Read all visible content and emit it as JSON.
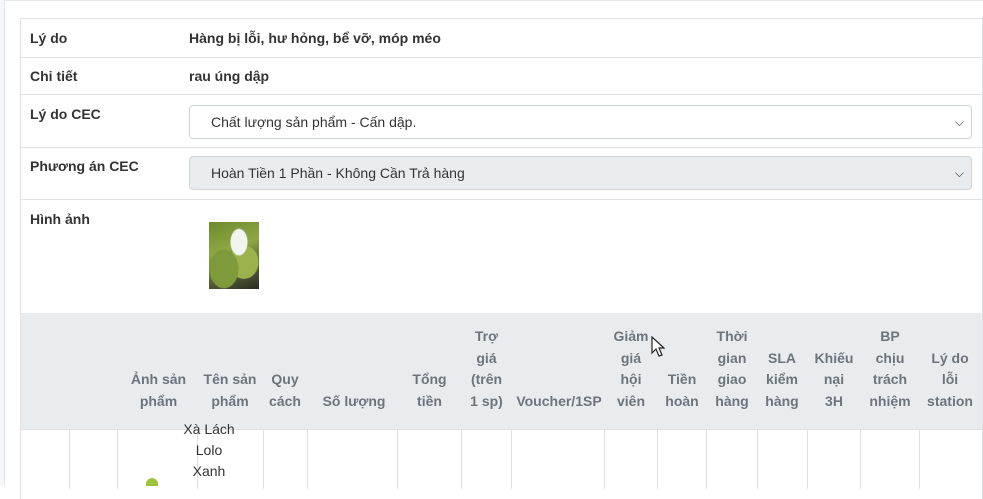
{
  "details": {
    "reason": {
      "label": "Lý do",
      "value": "Hàng bị lỗi, hư hỏng, bể vỡ, móp méo"
    },
    "detail": {
      "label": "Chi tiết",
      "value": "rau úng dập"
    },
    "cec_reason": {
      "label": "Lý do CEC",
      "selected": "Chất lượng sản phẩm - Cấn dập."
    },
    "cec_option": {
      "label": "Phương án CEC",
      "selected": "Hoàn Tiền 1 Phần - Không Cần Trả hàng"
    },
    "images": {
      "label": "Hình ảnh"
    }
  },
  "table": {
    "headers": [
      "",
      "",
      "Ảnh sản\nphẩm",
      "Tên sản\nphẩm",
      "Quy\ncách",
      "Số lượng",
      "Tổng\ntiền",
      "Trợ\ngiá\n(trên\n1 sp)",
      "Voucher/1SP",
      "Giảm\ngiá\nhội\nviên",
      "Tiền\nhoàn",
      "Thời\ngian\ngiao\nhàng",
      "SLA\nkiểm\nhàng",
      "Khiếu\nnại\n3H",
      "BP\nchịu\ntrách\nnhiệm",
      "Lý do\nlỗi\nstation"
    ],
    "row1_product_name": "Xà Lách\nLolo\nXanh"
  }
}
